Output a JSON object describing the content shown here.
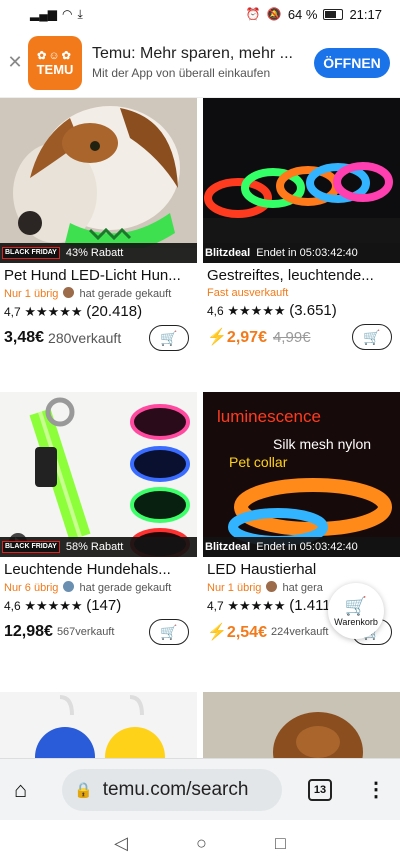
{
  "status_bar": {
    "alarm_icon": "alarm-icon",
    "battery_percent": "64 %",
    "time": "21:17"
  },
  "banner": {
    "logo_text": "TEMU",
    "title": "Temu: Mehr sparen, mehr ...",
    "subtitle": "Mit der App von überall einkaufen",
    "open_button": "ÖFFNEN"
  },
  "products": [
    {
      "promo": "43% Rabatt",
      "promo_tag": "BLACK FRIDAY",
      "title": "Pet Hund LED-Licht Hun...",
      "stock": "Nur 1 übrig",
      "activity": "hat gerade gekauft",
      "rating": "4,7",
      "stars": "★★★★★",
      "reviews": "(20.418)",
      "price": "3,48€",
      "sold": "280verkauft"
    },
    {
      "promo_label": "Blitzdeal",
      "promo_end": "Endet in 05:03:42:40",
      "title": "Gestreiftes, leuchtende...",
      "stock": "Fast ausverkauft",
      "rating": "4,6",
      "stars": "★★★★★",
      "reviews": "(3.651)",
      "price": "2,97€",
      "old_price": "4,99€"
    },
    {
      "promo": "58% Rabatt",
      "promo_tag": "BLACK FRIDAY",
      "title": "Leuchtende Hundehals...",
      "stock": "Nur 6 übrig",
      "activity": "hat gerade gekauft",
      "rating": "4,6",
      "stars": "★★★★★",
      "reviews": "(147)",
      "price": "12,98€",
      "sold": "567verkauft"
    },
    {
      "promo_label": "Blitzdeal",
      "promo_end": "Endet in 05:03:42:40",
      "image_text_1": "luminescence",
      "image_text_2": "Silk mesh nylon",
      "image_text_3": "Pet collar",
      "title": "LED Haustierhal",
      "stock": "Nur 1 übrig",
      "activity": "hat gera",
      "rating": "4,7",
      "stars": "★★★★★",
      "reviews": "(1.411)",
      "price": "2,54€",
      "sold": "224verkauft"
    }
  ],
  "floating_cart": {
    "label": "Warenkorb"
  },
  "browser": {
    "url": "temu.com/search",
    "tab_count": "13"
  }
}
